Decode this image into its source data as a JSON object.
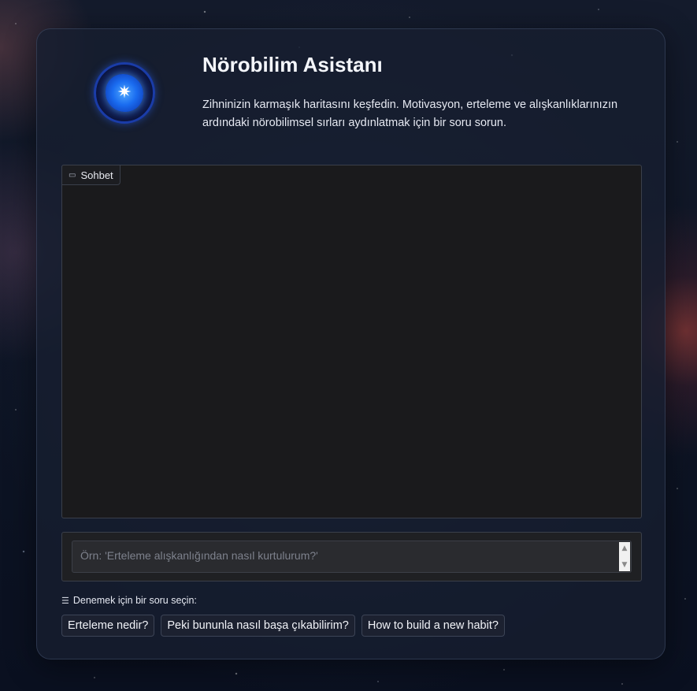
{
  "header": {
    "title": "Nörobilim Asistanı",
    "description": "Zihninizin karmaşık haritasını keşfedin. Motivasyon, erteleme ve alışkanlıklarınızın ardındaki nörobilimsel sırları aydınlatmak için bir soru sorun.",
    "logo_icon": "brain-star-icon"
  },
  "chat": {
    "tab_label": "Sohbet",
    "tab_icon": "chat-bubble-icon",
    "messages": []
  },
  "input": {
    "value": "",
    "placeholder": "Örn: 'Erteleme alışkanlığından nasıl kurtulurum?'"
  },
  "examples": {
    "label": "Denemek için bir soru seçin:",
    "icon": "list-icon",
    "items": [
      {
        "label": "Erteleme nedir?"
      },
      {
        "label": "Peki bununla nasıl başa çıkabilirim?"
      },
      {
        "label": "How to build a new habit?"
      }
    ]
  },
  "colors": {
    "panel_bg": "#161e30",
    "chat_bg": "#1a1a1c",
    "logo_accent": "#1a6cf0"
  }
}
